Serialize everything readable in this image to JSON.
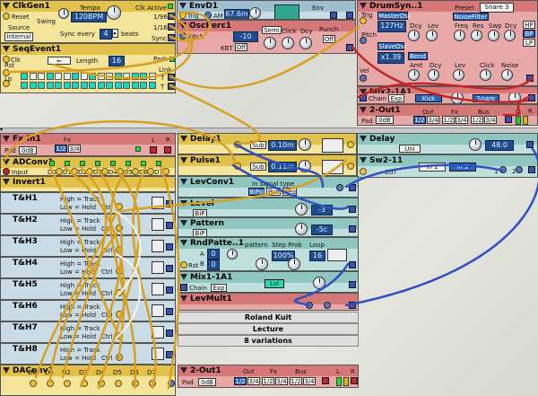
{
  "top_left_icon": "triangle-collapse-icon",
  "clkgen": {
    "title": "ClkGen1",
    "reset": "Reset",
    "swing_label": "Swing",
    "tempo_label": "Tempo",
    "tempo_value": "120BPM",
    "clk_active": "Clk Active",
    "rate1": "1/96",
    "rate2": "1/16",
    "source_label": "Source",
    "source_value": "Internal",
    "sync_every": "Sync every",
    "beats_value": "4",
    "beats_label": "beats",
    "sync": "Sync"
  },
  "seqevent": {
    "title": "SeqEvent1",
    "clk": "Clk",
    "rst": "Rst",
    "lp": "Lp",
    "length_label": "Length",
    "length_value": "16",
    "park": "Park",
    "link": "Link",
    "t1": "T",
    "t2": "T"
  },
  "envd": {
    "title": "EnvD1",
    "trig": "Trig",
    "am": "AM",
    "time_value": "67.6m",
    "env": "Env"
  },
  "oscperc": {
    "title": "OscPerc1",
    "pitch": "Pitch",
    "kbt": "KBT",
    "kbt_value": "Off",
    "semi": "Semi",
    "punch": "Punch",
    "punch_value": "Off",
    "click": "Click",
    "dcy": "Dcy",
    "freq_value": "-10"
  },
  "drumsyn": {
    "title": "DrumSyn..1",
    "preset_label": "Preset",
    "preset_value": "Snare 3",
    "trig": "Trig",
    "master_osc": "MasterOsc",
    "freq_value": "127Hz",
    "dcy": "Dcy",
    "lev": "Lev",
    "pitch": "Pitch",
    "slave_osc": "SlaveOsc",
    "ratio_value": "x1.39",
    "noise_filter": "NoiseFilter",
    "freq": "Freq",
    "res": "Res",
    "swp": "Swp",
    "hp": "HP",
    "bp": "BP",
    "lp": "LP",
    "vel": "Vel",
    "bend": "Bend",
    "amt": "Amt",
    "click": "Click",
    "noise": "Noise"
  },
  "mix2": {
    "title": "Mix2-1A1",
    "chain": "Chain",
    "exp": "Exp",
    "kick": "Kick",
    "snare": "Snare"
  },
  "out2_top": {
    "title": "2-Out1",
    "pad": "Pad",
    "pad_value": "0dB",
    "out_label": "Out",
    "fx_label": "Fx",
    "bus_label": "Bus",
    "btns": [
      "1/2",
      "3/4",
      "1/2",
      "3/4",
      "1/2",
      "3/4"
    ],
    "l": "L",
    "r": "R"
  },
  "fxin": {
    "title": "Fx-In1",
    "pad": "Pad",
    "pad_value": "0dB",
    "fx": "Fx",
    "b1": "1/2",
    "b2": "3/4",
    "l": "L",
    "r": "R"
  },
  "adconv": {
    "title": "ADConv1",
    "input": "Input",
    "outs": [
      "D0",
      "D1",
      "D2",
      "D3",
      "D4",
      "D5",
      "D6",
      "D7"
    ]
  },
  "invert": {
    "title": "Invert1"
  },
  "th_modules": [
    {
      "title": "T&H1",
      "high": "High = Track",
      "low": "Low = Hold",
      "ctrl": "Ctrl"
    },
    {
      "title": "T&H2",
      "high": "High = Track",
      "low": "Low = Hold",
      "ctrl": "Ctrl"
    },
    {
      "title": "T&H3",
      "high": "High = Track",
      "low": "Low = Hold",
      "ctrl": "Ctrl"
    },
    {
      "title": "T&H4",
      "high": "High = Track",
      "low": "Low = Hold",
      "ctrl": "Ctrl"
    },
    {
      "title": "T&H5",
      "high": "High = Track",
      "low": "Low = Hold",
      "ctrl": "Ctrl"
    },
    {
      "title": "T&H6",
      "high": "High = Track",
      "low": "Low = Hold",
      "ctrl": "Ctrl"
    },
    {
      "title": "T&H7",
      "high": "High = Track",
      "low": "Low = Hold",
      "ctrl": "Ctrl"
    },
    {
      "title": "T&H8",
      "high": "High = Track",
      "low": "Low = Hold",
      "ctrl": "Ctrl"
    }
  ],
  "daconv": {
    "title": "DAConv1",
    "ins": [
      "D0",
      "D1",
      "D2",
      "D3",
      "D4",
      "D5",
      "D6",
      "D7"
    ]
  },
  "out2_bottom": {
    "title": "2-Out1",
    "pad": "Pad",
    "pad_value": "0dB",
    "out_label": "Out",
    "fx_label": "Fx",
    "bus_label": "Bus",
    "btns": [
      "1/2",
      "3/4",
      "1/2",
      "3/4",
      "1/2",
      "3/4"
    ],
    "l": "L",
    "r": "R"
  },
  "delay1": {
    "title": "Delay1",
    "sub": "Sub",
    "time_value": "0.10m"
  },
  "pulse1": {
    "title": "Pulse1",
    "sub": "Sub",
    "time_value": "0.11m"
  },
  "delay_big": {
    "title": "Delay",
    "uni": "Uni",
    "value": "48.0"
  },
  "sw2": {
    "title": "Sw2-11",
    "ctrl": "Ctrl",
    "in1": "In 1",
    "in2": "In 2",
    "n1": "1",
    "n2": "2"
  },
  "levconv": {
    "title": "LevConv1",
    "in_signal_type": "In signal type",
    "bipol": "BiPol",
    "pos": "Pos",
    "neg": "Neg"
  },
  "level": {
    "title": "Level",
    "bip": "BiP",
    "value": "-3"
  },
  "pattern": {
    "title": "Pattern",
    "bip": "BiP",
    "value": "-5c"
  },
  "rndpattern": {
    "title": "RndPatte..1",
    "pattern": "pattern",
    "step_prob": "Step Prob",
    "loop": "Loop",
    "a_label": "A",
    "a_value": "0",
    "b_label": "B",
    "b_value": "0",
    "prob_value": "100%",
    "loop_value": "16",
    "rst": "Rst"
  },
  "mix1": {
    "title": "Mix1-1A1",
    "chain": "Chain",
    "exp": "Exp",
    "level_value": "Lvl"
  },
  "levmult": {
    "title": "LevMult1"
  },
  "info": {
    "line1": "Roland Kuit",
    "line2": "Lecture",
    "line3": "8 variations"
  },
  "colors": {
    "yellow_module": "#f4e59a",
    "blue_module": "#c9dce6",
    "red_module": "#e8a8a8",
    "teal_module": "#bfe0dc",
    "cable_yellow": "#d8a020",
    "cable_blue": "#3050c0",
    "cable_red": "#c02828",
    "cable_white": "#f4f4f4"
  }
}
